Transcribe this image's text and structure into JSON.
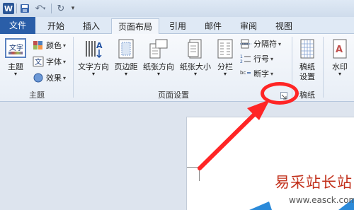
{
  "colors": {
    "accent": "#2a5ea8",
    "annotation": "#ff2525"
  },
  "quick_access": {
    "app_icon": "W",
    "items": [
      "save-icon",
      "undo-icon",
      "redo-icon",
      "customize-dropdown-icon"
    ]
  },
  "tabs": [
    "文件",
    "开始",
    "插入",
    "页面布局",
    "引用",
    "邮件",
    "审阅",
    "视图"
  ],
  "active_tab": "页面布局",
  "groups": {
    "theme": {
      "label": "主题",
      "main_button": "主题",
      "small": [
        {
          "label": "颜色",
          "icon": "color-palette-icon"
        },
        {
          "label": "字体",
          "icon": "font-icon"
        },
        {
          "label": "效果",
          "icon": "effects-icon"
        }
      ]
    },
    "page_setup": {
      "label": "页面设置",
      "buttons": [
        {
          "label": "文字方向",
          "icon": "text-direction-icon"
        },
        {
          "label": "页边距",
          "icon": "margins-icon"
        },
        {
          "label": "纸张方向",
          "icon": "orientation-icon"
        },
        {
          "label": "纸张大小",
          "icon": "paper-size-icon"
        },
        {
          "label": "分栏",
          "icon": "columns-icon"
        }
      ],
      "small": [
        {
          "label": "分隔符",
          "icon": "breaks-icon"
        },
        {
          "label": "行号",
          "icon": "line-numbers-icon"
        },
        {
          "label": "断字",
          "icon": "hyphenation-icon"
        }
      ]
    },
    "draft": {
      "label": "稿纸",
      "button_line1": "稿纸",
      "button_line2": "设置"
    },
    "background": {
      "button": "水印"
    }
  },
  "watermark": {
    "text": "易采站长站",
    "url": "www.easck.com"
  }
}
